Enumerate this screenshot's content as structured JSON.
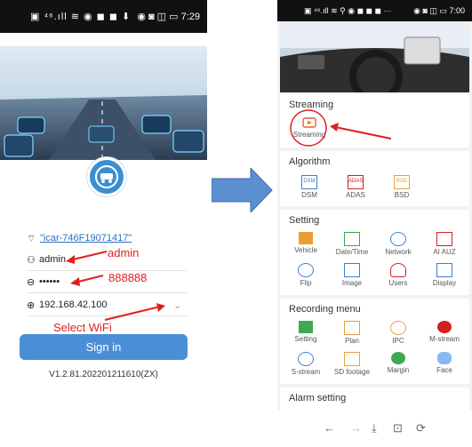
{
  "left": {
    "status": {
      "left_icons": "▣ ⁴⁶.ıll ≋ ◉ ◼ ◼ ⬇",
      "right_icons": "◉ ◙ ◫ ▭",
      "time": "7:29"
    },
    "wifi": {
      "ssid": "\"icar-746F19071417\""
    },
    "username": {
      "value": "admin",
      "annotation": "admin"
    },
    "password": {
      "value": "••••••",
      "annotation": "888888"
    },
    "ip": {
      "value": "192.168.42.100",
      "annotation": "Select WiFi"
    },
    "sign_in_label": "Sign in",
    "version": "V1.2.81.202201211610(ZX)"
  },
  "right": {
    "status": {
      "left_icons": "▣ ⁴⁶.ıll ≋ ⚲ ◉ ◼ ◼ ◼ ···",
      "right_icons": "◉ ◙ ◫ ▭",
      "time": "7:00"
    },
    "sections": {
      "streaming": {
        "title": "Streaming",
        "items": [
          {
            "label": "Streaming",
            "icon": "streaming-icon"
          }
        ]
      },
      "algorithm": {
        "title": "Algorithm",
        "items": [
          {
            "label": "DSM",
            "badge": "DSM"
          },
          {
            "label": "ADAS",
            "badge": "ADAS"
          },
          {
            "label": "BSD",
            "badge": "BSD"
          }
        ]
      },
      "setting": {
        "title": "Setting",
        "items": [
          {
            "label": "Vehicle"
          },
          {
            "label": "Date/Time"
          },
          {
            "label": "Network"
          },
          {
            "label": "AI AUZ"
          },
          {
            "label": "Flip"
          },
          {
            "label": "Image"
          },
          {
            "label": "Users"
          },
          {
            "label": "Display"
          }
        ]
      },
      "recording": {
        "title": "Recording menu",
        "items": [
          {
            "label": "Setting"
          },
          {
            "label": "Plan"
          },
          {
            "label": "IPC"
          },
          {
            "label": "M-stream"
          },
          {
            "label": "S-stream"
          },
          {
            "label": "SD footage"
          },
          {
            "label": "Margin"
          },
          {
            "label": "Face"
          }
        ]
      },
      "alarm": {
        "title": "Alarm setting"
      }
    },
    "nav": {
      "back": "←",
      "forward": "→",
      "download": "⤓",
      "tabs": "⊡",
      "reload": "⟳"
    }
  },
  "colors": {
    "accent": "#4a8fd6",
    "annotation": "#e02020",
    "arrow": "#5b8fd0"
  }
}
